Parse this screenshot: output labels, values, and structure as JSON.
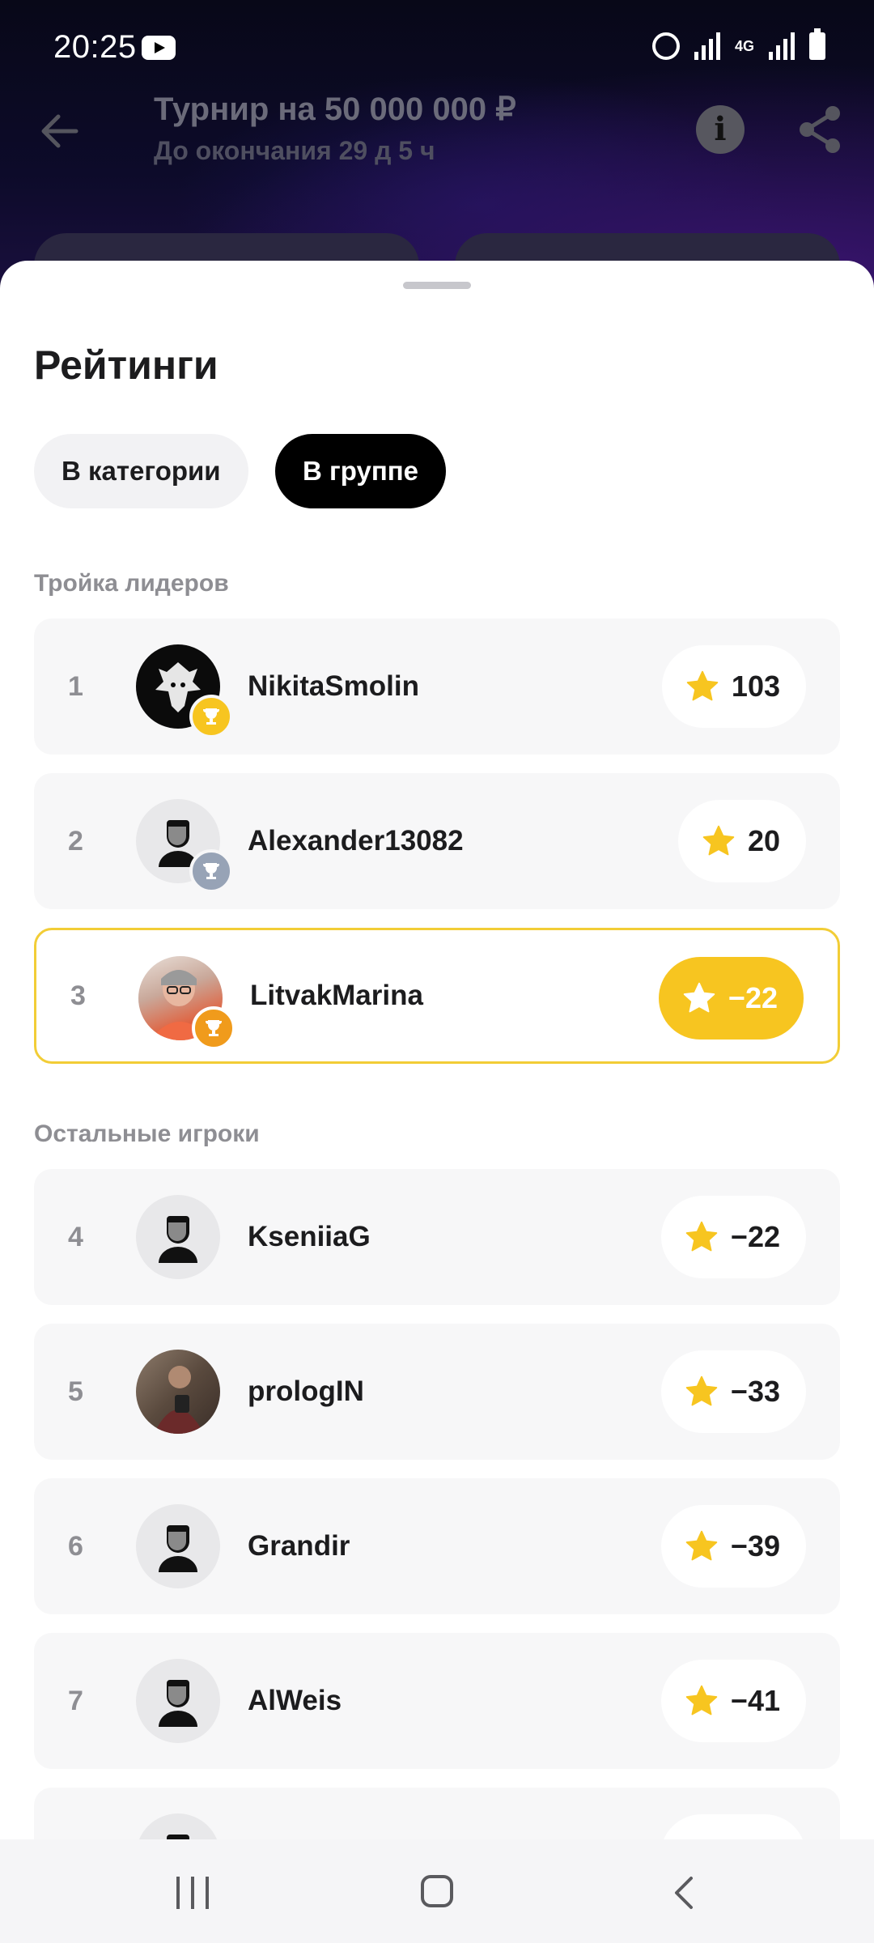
{
  "status_bar": {
    "time": "20:25",
    "network": "4G"
  },
  "header": {
    "title": "Турнир на 50 000 000 ₽",
    "subtitle": "До окончания 29 д 5 ч"
  },
  "sheet": {
    "title": "Рейтинги",
    "tabs": [
      {
        "label": "В категории",
        "selected": false
      },
      {
        "label": "В группе",
        "selected": true
      }
    ],
    "leaders_label": "Тройка лидеров",
    "others_label": "Остальные игроки",
    "leaders": [
      {
        "rank": "1",
        "name": "NikitaSmolin",
        "score": "103",
        "badge": "gold-cup"
      },
      {
        "rank": "2",
        "name": "Alexander13082",
        "score": "20",
        "badge": "silver-cup"
      },
      {
        "rank": "3",
        "name": "LitvakMarina",
        "score": "−22",
        "badge": "bronze-cup",
        "current_user": true
      }
    ],
    "others": [
      {
        "rank": "4",
        "name": "KseniiaG",
        "score": "−22"
      },
      {
        "rank": "5",
        "name": "prologIN",
        "score": "−33"
      },
      {
        "rank": "6",
        "name": "Grandir",
        "score": "−39"
      },
      {
        "rank": "7",
        "name": "AlWeis",
        "score": "−41"
      }
    ]
  },
  "colors": {
    "accent_yellow": "#f7c520",
    "highlight_border": "#f2cd36",
    "row_bg": "#f7f7f8",
    "muted_text": "#8e8e93"
  }
}
